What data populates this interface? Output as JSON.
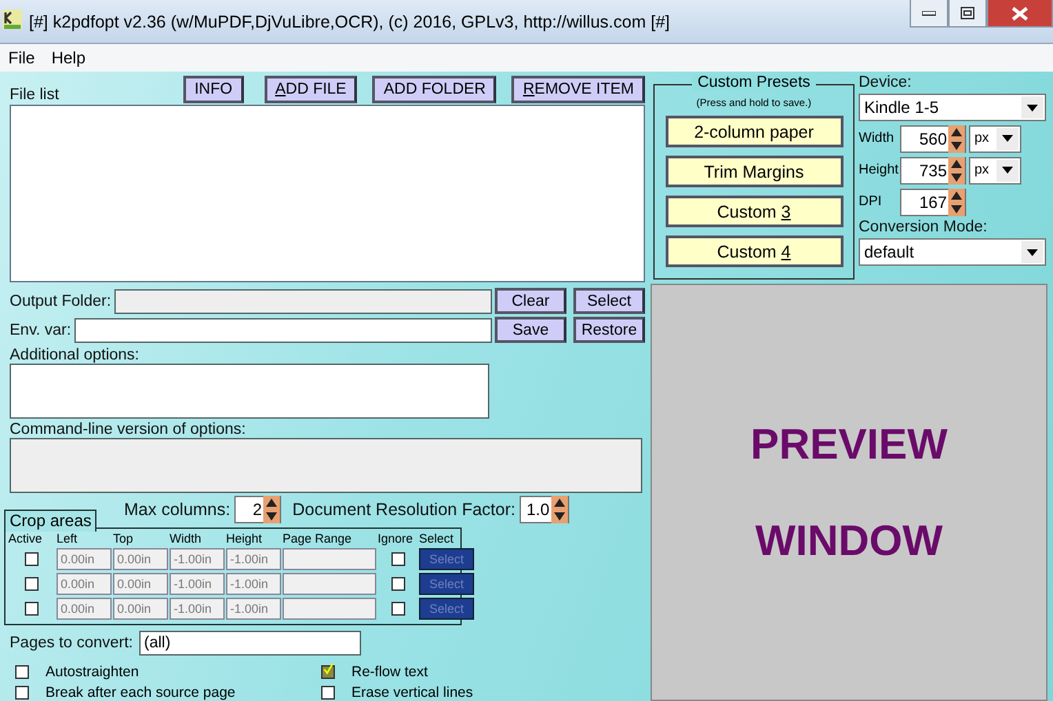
{
  "window": {
    "title": "[#] k2pdfopt v2.36 (w/MuPDF,DjVuLibre,OCR), (c) 2016, GPLv3, http://willus.com [#]"
  },
  "menu": [
    "File",
    "Help"
  ],
  "file_list": {
    "label": "File list",
    "buttons": [
      {
        "label": "INFO"
      },
      {
        "label": [
          {
            "text": "A",
            "underlined": true
          },
          {
            "text": "DD FILE",
            "underlined": false
          }
        ]
      },
      {
        "label": "ADD FOLDER"
      },
      {
        "label": [
          {
            "text": "R",
            "underlined": true
          },
          {
            "text": "EMOVE ITEM",
            "underlined": false
          }
        ]
      }
    ]
  },
  "output_folder": {
    "label": "Output Folder:",
    "buttons": [
      "Clear",
      "Select"
    ]
  },
  "env_var": {
    "label": "Env. var:",
    "buttons": [
      "Save",
      "Restore"
    ]
  },
  "additional_options": {
    "label": "Additional options:"
  },
  "command_line": {
    "label": "Command-line version of options:"
  },
  "max_columns": {
    "label": "Max columns:",
    "value": "2"
  },
  "resolution_factor": {
    "label": "Document Resolution Factor:",
    "value": "1.0"
  },
  "crop_areas": {
    "title": "Crop areas",
    "columns": [
      "Active",
      "Left",
      "Top",
      "Width",
      "Height",
      "Page Range",
      "Ignore",
      "Select"
    ],
    "rows": [
      {
        "active": false,
        "left": "0.00in",
        "top": "0.00in",
        "width": "-1.00in",
        "height": "-1.00in",
        "ignore": false,
        "select": "Select"
      },
      {
        "active": false,
        "left": "0.00in",
        "top": "0.00in",
        "width": "-1.00in",
        "height": "-1.00in",
        "ignore": false,
        "select": "Select"
      },
      {
        "active": false,
        "left": "0.00in",
        "top": "0.00in",
        "width": "-1.00in",
        "height": "-1.00in",
        "ignore": false,
        "select": "Select"
      }
    ]
  },
  "pages_to_convert": {
    "label": "Pages to convert:",
    "value": "(all)"
  },
  "options": [
    {
      "label": "Autostraighten",
      "checked": false
    },
    {
      "label": "Re-flow text",
      "checked": true
    },
    {
      "label": "Break after each source page",
      "checked": false
    },
    {
      "label": "Erase vertical lines",
      "checked": false
    }
  ],
  "custom_presets": {
    "title": "Custom Presets",
    "hint": "(Press and hold to save.)",
    "buttons": [
      {
        "label": "2-column paper"
      },
      {
        "label": "Trim Margins"
      },
      {
        "label": [
          {
            "text": "Custom ",
            "underlined": false
          },
          {
            "text": "3",
            "underlined": true
          }
        ]
      },
      {
        "label": [
          {
            "text": "Custom ",
            "underlined": false
          },
          {
            "text": "4",
            "underlined": true
          }
        ]
      }
    ]
  },
  "device": {
    "label": "Device:",
    "value": "Kindle 1-5",
    "width": {
      "label": "Width",
      "value": "560",
      "unit": "px"
    },
    "height": {
      "label": "Height",
      "value": "735",
      "unit": "px"
    },
    "dpi": {
      "label": "DPI",
      "value": "167"
    },
    "mode_label": "Conversion Mode:",
    "mode": "default"
  },
  "preview": [
    "PREVIEW",
    "WINDOW"
  ]
}
